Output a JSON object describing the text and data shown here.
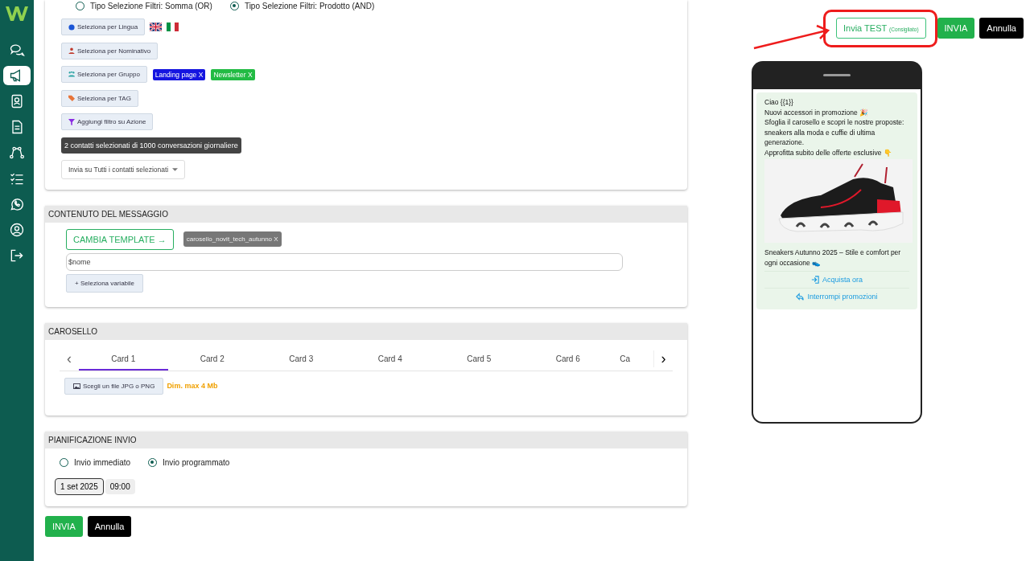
{
  "sidebar": {
    "items": [
      {
        "selected": false
      },
      {
        "selected": true
      },
      {
        "selected": false
      },
      {
        "selected": false
      },
      {
        "selected": false
      },
      {
        "selected": false
      },
      {
        "selected": false
      },
      {
        "selected": false
      },
      {
        "selected": false
      }
    ]
  },
  "filters": {
    "modes": [
      {
        "label": "Tipo Selezione Filtri: Somma (OR)",
        "selected": false
      },
      {
        "label": "Tipo Selezione Filtri: Prodotto (AND)",
        "selected": true
      }
    ],
    "buttons": [
      {
        "kind": "language",
        "label": "Seleziona per Lingua"
      },
      {
        "kind": "person",
        "label": "Seleziona per Nominativo"
      },
      {
        "kind": "group",
        "label": "Seleziona per Gruppo"
      },
      {
        "kind": "tag",
        "label": "Seleziona per TAG"
      },
      {
        "kind": "filter",
        "label": "Aggiungi filtro su Azione"
      }
    ],
    "groups": [
      {
        "label": "Landing page X",
        "color": "#1515e0"
      },
      {
        "label": "Newsletter X",
        "color": "#22bb44"
      }
    ],
    "summary": "2 contatti selezionati di 1000 conversazioni giornaliere",
    "send_target": "Invia su Tutti i contatti selezionati"
  },
  "content": {
    "title": "CONTENUTO DEL MESSAGGIO",
    "change_template": "CAMBIA TEMPLATE →",
    "template_chip": "carosello_novit_tech_autunno  X",
    "variable": "$nome",
    "add_variable": "+ Seleziona variabile"
  },
  "carousel": {
    "title": "CAROSELLO",
    "prev": "‹",
    "next": "›",
    "tabs": [
      {
        "label": "Card 1",
        "selected": true
      },
      {
        "label": "Card 2",
        "selected": false
      },
      {
        "label": "Card 3",
        "selected": false
      },
      {
        "label": "Card 4",
        "selected": false
      },
      {
        "label": "Card 5",
        "selected": false
      },
      {
        "label": "Card 6",
        "selected": false
      },
      {
        "label": "Ca",
        "selected": false
      }
    ],
    "file_button": "Scegli un file JPG o PNG",
    "max_size": "Dim. max 4 Mb"
  },
  "schedule": {
    "title": "PIANIFICAZIONE INVIO",
    "options": [
      {
        "label": "Invio immediato",
        "selected": false
      },
      {
        "label": "Invio programmato",
        "selected": true
      }
    ],
    "date": "1 set 2025",
    "time": "09:00"
  },
  "actions": {
    "send": "INVIA",
    "cancel": "Annulla"
  },
  "top_actions": {
    "test": "Invia TEST",
    "test_note": "(Consigliato)",
    "send": "INVIA",
    "cancel": "Annulla"
  },
  "preview": {
    "lines": [
      "Ciao {{1}}",
      "Nuovi accessori in promozione 🎉",
      "Sfoglia il carosello e scopri le nostre proposte: sneakers alla moda e cuffie di ultima generazione.",
      "Approfitta subito delle offerte esclusive 👇"
    ],
    "card_text": "Sneakers Autunno 2025 – Stile e comfort per ogni occasione 👟",
    "buttons": [
      {
        "kind": "link",
        "label": "Acquista ora"
      },
      {
        "kind": "reply",
        "label": "Interrompi promozioni"
      }
    ]
  }
}
